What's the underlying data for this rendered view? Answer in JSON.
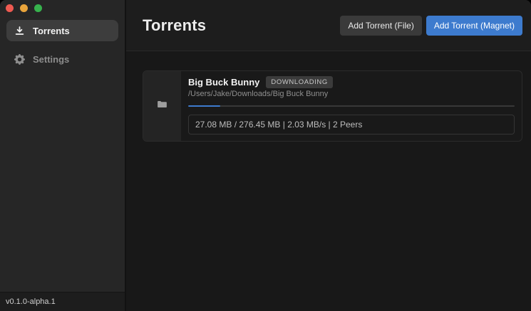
{
  "traffic_lights": [
    {
      "name": "close",
      "color": "#ef5a51"
    },
    {
      "name": "minimize",
      "color": "#e9a43b"
    },
    {
      "name": "zoom",
      "color": "#37b24d"
    }
  ],
  "sidebar": {
    "items": [
      {
        "label": "Torrents",
        "icon": "download-icon",
        "active": true
      },
      {
        "label": "Settings",
        "icon": "gear-icon",
        "active": false
      }
    ],
    "version_label": "v0.1.0-alpha.1"
  },
  "header": {
    "title": "Torrents",
    "add_file_label": "Add Torrent (File)",
    "add_magnet_label": "Add Torrent (Magnet)"
  },
  "torrent_list": [
    {
      "name": "Big Buck Bunny",
      "status_badge": "DOWNLOADING",
      "save_path": "/Users/Jake/Downloads/Big Buck Bunny",
      "progress_percent": 9.8,
      "downloaded": "27.08 MB",
      "total_size": "276.45 MB",
      "speed": "2.03 MB/s",
      "peers": "2 Peers",
      "stats_text": "27.08 MB / 276.45 MB | 2.03 MB/s | 2 Peers"
    }
  ],
  "colors": {
    "accent_blue": "#3d7bce",
    "sidebar_bg": "#262626",
    "main_bg": "#181818",
    "progress_track": "#383838"
  }
}
